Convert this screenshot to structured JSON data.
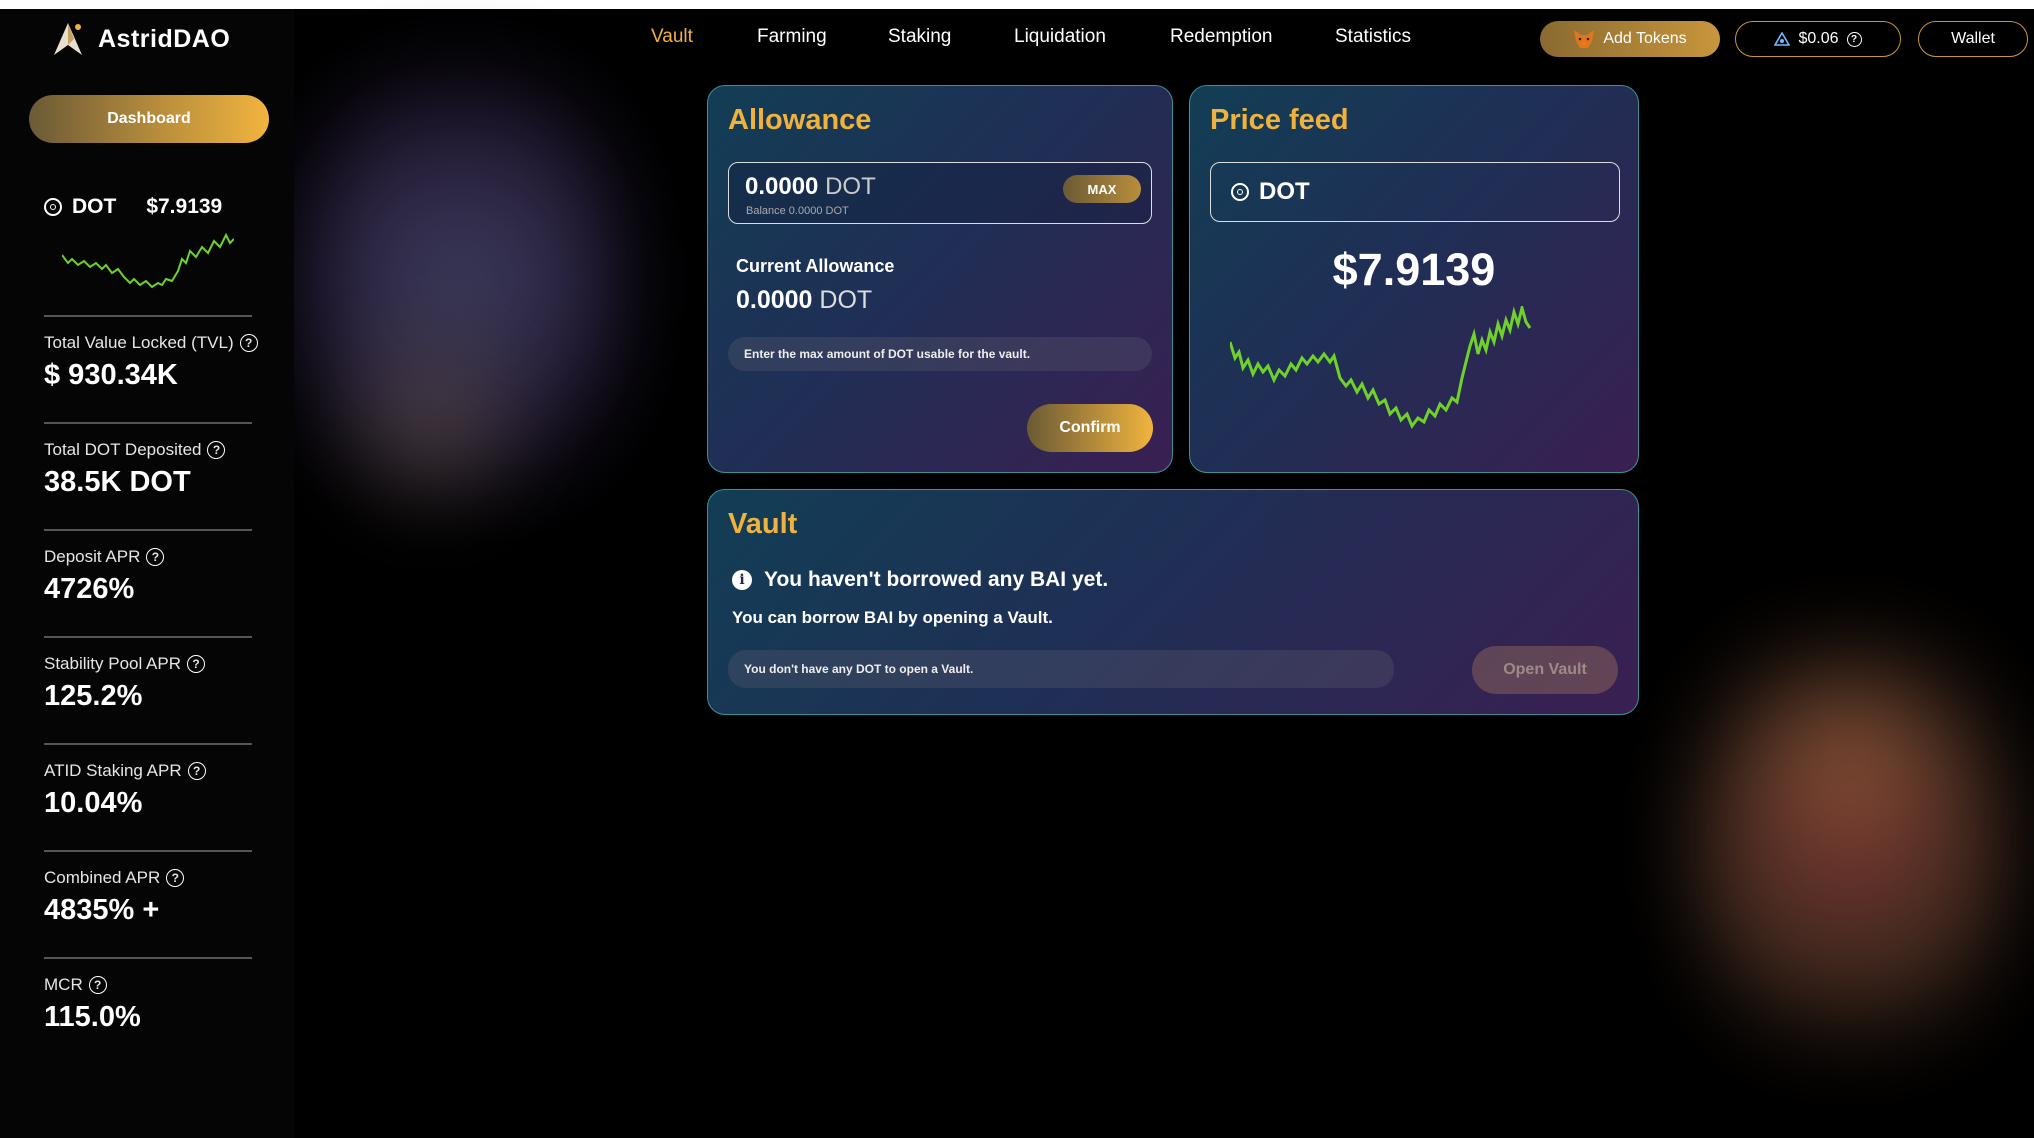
{
  "app": {
    "name": "AstridDAO"
  },
  "sidebar": {
    "dashboard_label": "Dashboard",
    "token": {
      "symbol": "DOT",
      "price": "$7.9139"
    },
    "stats": [
      {
        "label": "Total Value Locked (TVL)",
        "value": "$ 930.34K"
      },
      {
        "label": "Total DOT Deposited",
        "value": "38.5K DOT"
      },
      {
        "label": "Deposit APR",
        "value": "4726%"
      },
      {
        "label": "Stability Pool APR",
        "value": "125.2%"
      },
      {
        "label": "ATID Staking APR",
        "value": "10.04%"
      },
      {
        "label": "Combined APR",
        "value": "4835% +"
      },
      {
        "label": "MCR",
        "value": "115.0%"
      }
    ]
  },
  "nav": {
    "items": [
      "Vault",
      "Farming",
      "Staking",
      "Liquidation",
      "Redemption",
      "Statistics"
    ],
    "active": "Vault"
  },
  "header": {
    "add_tokens_label": "Add Tokens",
    "price_label": "$0.06",
    "wallet_label": "Wallet"
  },
  "allowance": {
    "title": "Allowance",
    "amount": "0.0000",
    "unit": "DOT",
    "balance_text": "Balance 0.0000 DOT",
    "max_label": "MAX",
    "current_label": "Current Allowance",
    "current_amount": "0.0000",
    "current_unit": "DOT",
    "hint": "Enter the max amount of DOT usable for the vault.",
    "confirm_label": "Confirm"
  },
  "price_feed": {
    "title": "Price feed",
    "token": "DOT",
    "price": "$7.9139"
  },
  "vault": {
    "title": "Vault",
    "notice": "You haven't borrowed any BAI yet.",
    "sub": "You can borrow BAI by opening a Vault.",
    "hint": "You don't have any DOT to open a Vault.",
    "open_label": "Open Vault"
  },
  "colors": {
    "accent": "#f0b23e",
    "chart_line": "#6fd12a",
    "card_border": "#3e8f96"
  },
  "icons": [
    "astrid-logo-icon",
    "dot-token-icon",
    "question-icon",
    "metamask-fox-icon",
    "astar-icon",
    "info-icon"
  ]
}
